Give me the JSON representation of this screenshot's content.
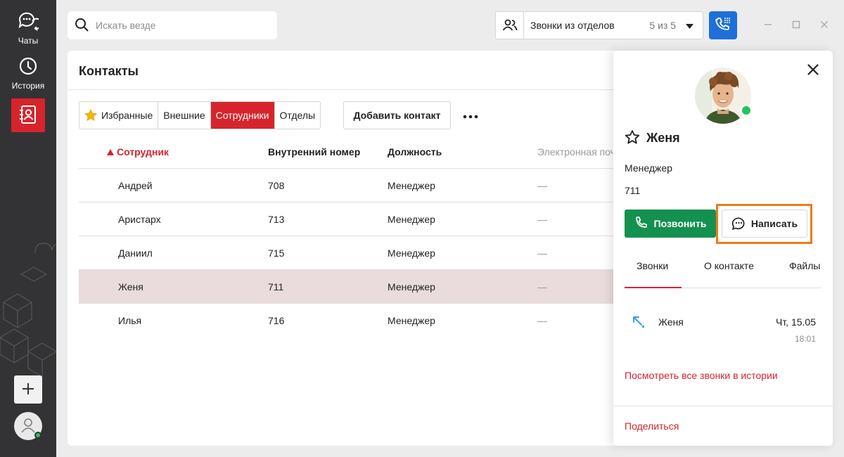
{
  "sidebar": {
    "items": [
      {
        "label": "Чаты",
        "icon": "chat-icon"
      },
      {
        "label": "История",
        "icon": "history-clock-icon"
      },
      {
        "label": "",
        "icon": "contacts-icon"
      }
    ],
    "add_icon": "plus-icon",
    "user_icon": "user-avatar-icon",
    "active_color": "#d7242c"
  },
  "search": {
    "placeholder": "Искать везде",
    "value": ""
  },
  "dept_filter": {
    "label": "Звонки из отделов",
    "count": "5 из 5"
  },
  "contacts": {
    "title": "Контакты",
    "tabs": [
      {
        "label": "Избранные",
        "active": false
      },
      {
        "label": "Внешние",
        "active": false
      },
      {
        "label": "Сотрудники",
        "active": true
      },
      {
        "label": "Отделы",
        "active": false
      }
    ],
    "add_contact_label": "Добавить контакт",
    "columns": [
      "Сотрудник",
      "Внутренний номер",
      "Должность",
      "Электронная почта"
    ],
    "rows": [
      {
        "name": "Андрей",
        "ext": "708",
        "role": "Менеджер",
        "email": "—"
      },
      {
        "name": "Аристарх",
        "ext": "713",
        "role": "Менеджер",
        "email": "—"
      },
      {
        "name": "Даниил",
        "ext": "715",
        "role": "Менеджер",
        "email": "—"
      },
      {
        "name": "Женя",
        "ext": "711",
        "role": "Менеджер",
        "email": "—",
        "selected": true
      },
      {
        "name": "Илья",
        "ext": "716",
        "role": "Менеджер",
        "email": "—"
      }
    ]
  },
  "panel": {
    "name": "Женя",
    "role": "Менеджер",
    "ext": "711",
    "call_label": "Позвонить",
    "write_label": "Написать",
    "tabs": [
      "Звонки",
      "О контакте",
      "Файлы"
    ],
    "calls": [
      {
        "name": "Женя",
        "date": "Чт, 15.05",
        "time": "18:01"
      }
    ],
    "view_all_label": "Посмотреть все звонки в истории",
    "share_label": "Поделиться"
  },
  "colors": {
    "accent_red": "#d7242c",
    "call_green": "#14914e",
    "call_blue": "#1e6fd9",
    "highlight_orange": "#f07a1a",
    "online_green": "#22c55e"
  }
}
